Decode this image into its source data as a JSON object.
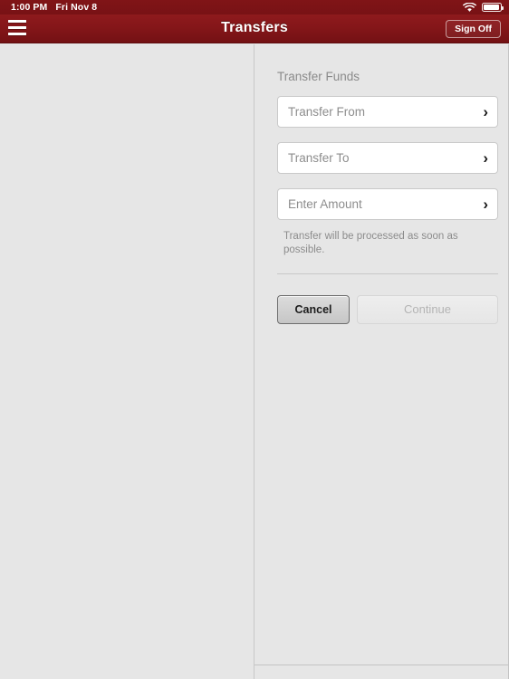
{
  "status_bar": {
    "time": "1:00 PM",
    "date": "Fri Nov 8",
    "wifi_icon": "wifi-icon",
    "battery_icon": "battery-full-icon"
  },
  "nav_bar": {
    "menu_icon": "hamburger-menu-icon",
    "title": "Transfers",
    "sign_off_label": "Sign Off",
    "background_color": "#851619"
  },
  "transfer_form": {
    "section_title": "Transfer Funds",
    "fields": [
      {
        "name": "transfer-from",
        "placeholder": "Transfer From",
        "value": "",
        "chevron": "›"
      },
      {
        "name": "transfer-to",
        "placeholder": "Transfer To",
        "value": "",
        "chevron": "›"
      },
      {
        "name": "enter-amount",
        "placeholder": "Enter Amount",
        "value": "",
        "chevron": "›"
      }
    ],
    "note": "Transfer will be processed as soon as possible.",
    "cancel_label": "Cancel",
    "continue_label": "Continue",
    "continue_disabled": true
  },
  "theme": {
    "brand_red": "#851619",
    "status_bar_red": "#7a1316",
    "panel_bg": "#e6e6e6",
    "field_bg": "#ffffff",
    "placeholder_color": "#8d8d8d",
    "divider_color": "#c8c8c8"
  }
}
